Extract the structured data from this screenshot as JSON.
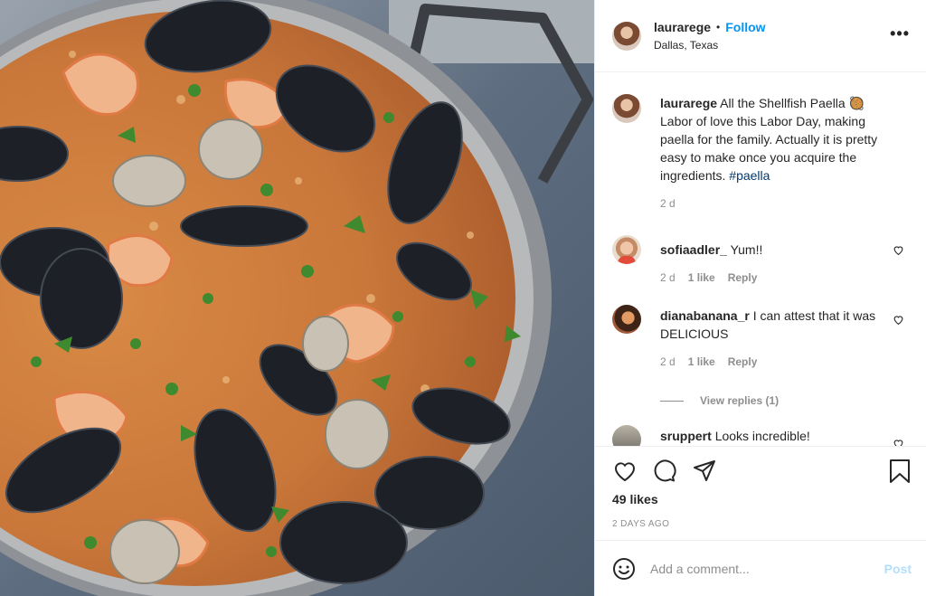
{
  "post": {
    "author": "laurarege",
    "follow_label": "Follow",
    "separator": "•",
    "location": "Dallas, Texas",
    "more_label": "•••"
  },
  "caption": {
    "author": "laurarege",
    "text": "All the Shellfish Paella 🥘 Labor of love this Labor Day, making paella for the family. Actually it is pretty easy to make once you acquire the ingredients.",
    "hashtag": "#paella",
    "time": "2 d"
  },
  "comments": [
    {
      "author": "sofiaadler_",
      "text": "Yum!!",
      "time": "2 d",
      "likes": "1 like",
      "reply": "Reply"
    },
    {
      "author": "dianabanana_r",
      "text": "I can attest that it was DELICIOUS",
      "time": "2 d",
      "likes": "1 like",
      "reply": "Reply"
    },
    {
      "author": "sruppert",
      "text": "Looks incredible!"
    }
  ],
  "view_replies": "View replies (1)",
  "likes": "49 likes",
  "posted_ago": "2 DAYS AGO",
  "comment_box": {
    "placeholder": "Add a comment...",
    "post_label": "Post"
  },
  "colors": {
    "link_blue": "#0095f6",
    "hashtag": "#00376b",
    "muted": "#8e8e8e",
    "post_disabled": "#b2dffc"
  },
  "icons": [
    "like-icon",
    "comment-icon",
    "share-icon",
    "bookmark-icon",
    "emoji-icon",
    "more-icon",
    "comment-like-icon"
  ]
}
